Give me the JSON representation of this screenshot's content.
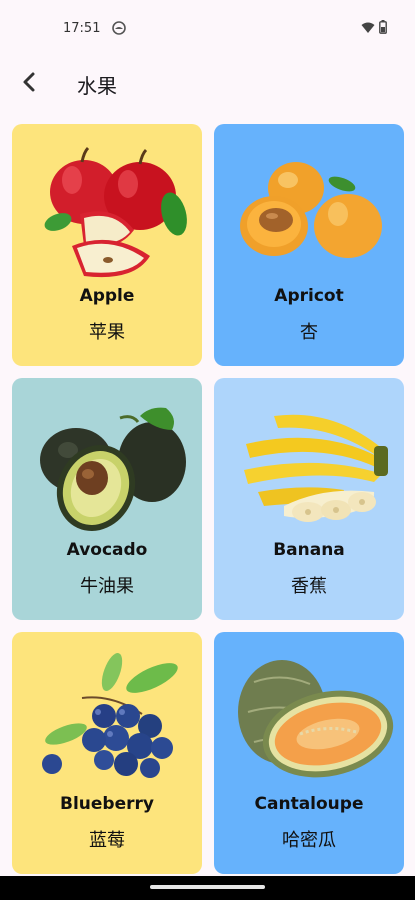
{
  "status": {
    "time": "17:51"
  },
  "header": {
    "title": "水果"
  },
  "colors": {
    "yellow": "#fde47c",
    "blue": "#66b2fc",
    "teal": "#a9d5d8",
    "light_blue": "#aed5fb"
  },
  "icons": {
    "back": "arrow-left-icon",
    "wifi": "wifi-icon",
    "battery": "battery-icon",
    "status_app": "android-circle-icon"
  },
  "fruits": [
    {
      "en": "Apple",
      "zh": "苹果",
      "bg": "#fde47c"
    },
    {
      "en": "Apricot",
      "zh": "杏",
      "bg": "#66b2fc"
    },
    {
      "en": "Avocado",
      "zh": "牛油果",
      "bg": "#a9d5d8"
    },
    {
      "en": "Banana",
      "zh": "香蕉",
      "bg": "#aed5fb"
    },
    {
      "en": "Blueberry",
      "zh": "蓝莓",
      "bg": "#fde47c"
    },
    {
      "en": "Cantaloupe",
      "zh": "哈密瓜",
      "bg": "#66b2fc"
    }
  ]
}
